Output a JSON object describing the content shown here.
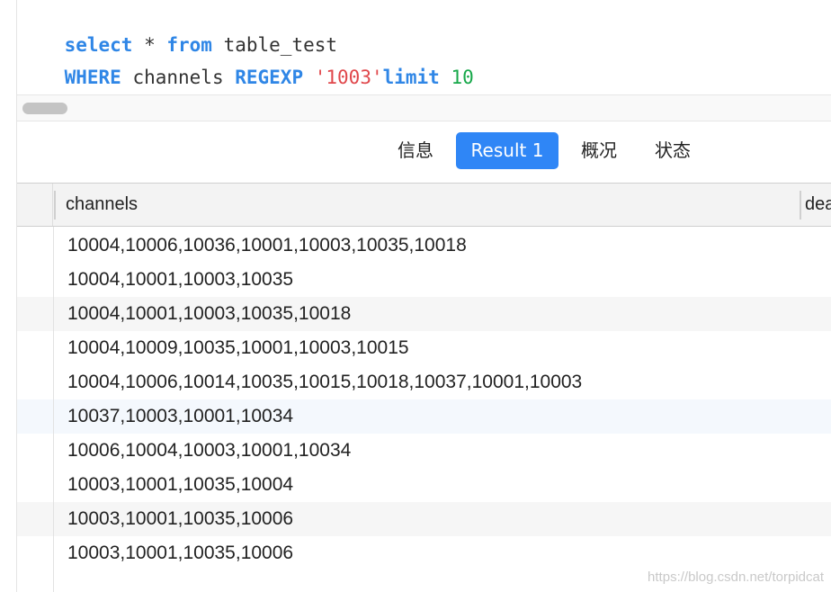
{
  "editor": {
    "line1": [
      {
        "text": "select",
        "style": "kw"
      },
      {
        "text": " * ",
        "style": "plain"
      },
      {
        "text": "from",
        "style": "kw"
      },
      {
        "text": " table_test",
        "style": "plain"
      }
    ],
    "line2": [
      {
        "text": "WHERE",
        "style": "kw"
      },
      {
        "text": " channels ",
        "style": "plain"
      },
      {
        "text": "REGEXP",
        "style": "kw"
      },
      {
        "text": " ",
        "style": "plain"
      },
      {
        "text": "'1003'",
        "style": "str"
      },
      {
        "text": "limit",
        "style": "kw"
      },
      {
        "text": " ",
        "style": "plain"
      },
      {
        "text": "10",
        "style": "num"
      }
    ]
  },
  "tabs": [
    {
      "label": "信息",
      "active": false
    },
    {
      "label": "Result 1",
      "active": true
    },
    {
      "label": "概况",
      "active": false
    },
    {
      "label": "状态",
      "active": false
    }
  ],
  "grid": {
    "columns": [
      "channels",
      "dea"
    ],
    "rows": [
      "10004,10006,10036,10001,10003,10035,10018",
      "10004,10001,10003,10035",
      "10004,10001,10003,10035,10018",
      "10004,10009,10035,10001,10003,10015",
      "10004,10006,10014,10035,10015,10018,10037,10001,10003",
      "10037,10003,10001,10034",
      "10006,10004,10003,10001,10034",
      "10003,10001,10035,10004",
      "10003,10001,10035,10006",
      "10003,10001,10035,10006"
    ]
  },
  "watermark": "https://blog.csdn.net/torpidcat",
  "colors": {
    "keyword": "#2f86e6",
    "string": "#e0474b",
    "number": "#17a84a",
    "active_tab": "#2f86f6"
  }
}
